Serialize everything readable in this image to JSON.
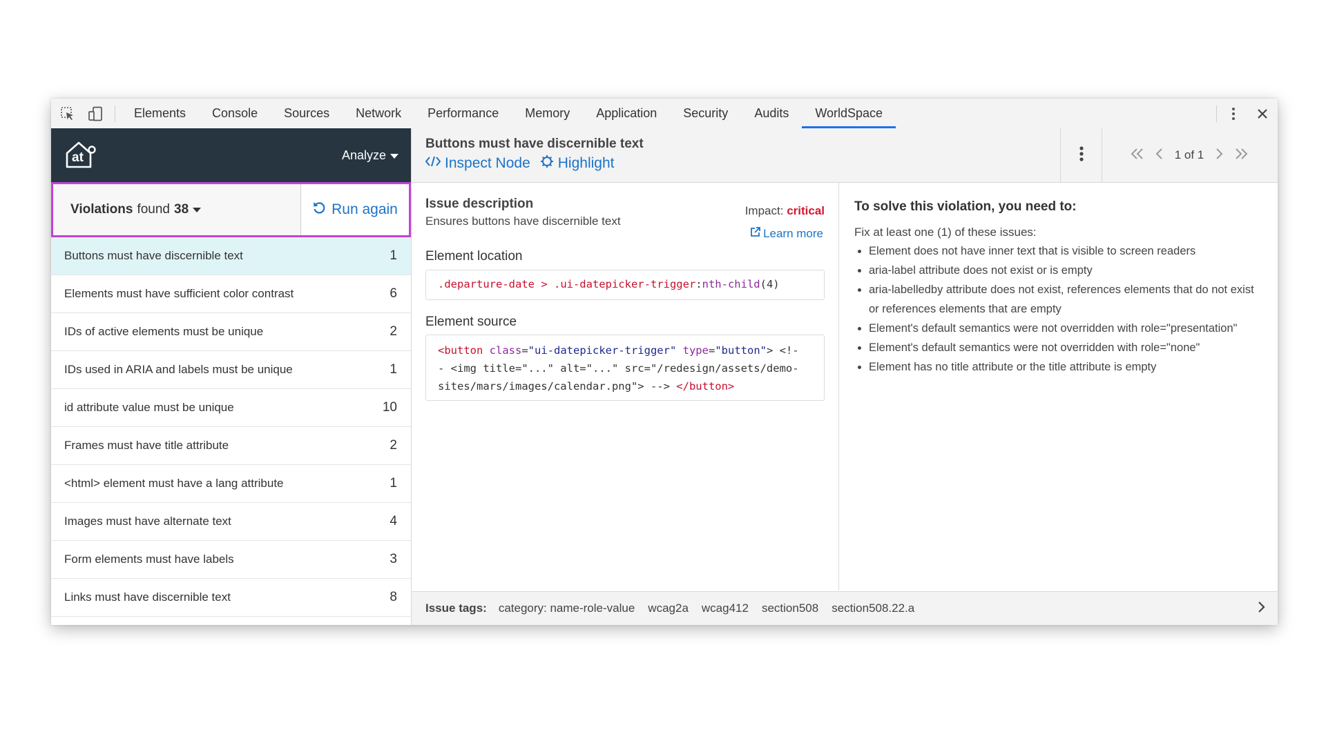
{
  "devtools": {
    "tabs": [
      {
        "label": "Elements"
      },
      {
        "label": "Console"
      },
      {
        "label": "Sources"
      },
      {
        "label": "Network"
      },
      {
        "label": "Performance"
      },
      {
        "label": "Memory"
      },
      {
        "label": "Application"
      },
      {
        "label": "Security"
      },
      {
        "label": "Audits"
      },
      {
        "label": "WorldSpace",
        "active": true
      }
    ]
  },
  "brand": {
    "logo_text": "at",
    "analyze_label": "Analyze"
  },
  "violations": {
    "label": "Violations",
    "found_label": "found",
    "count": "38",
    "run_again_label": "Run again",
    "items": [
      {
        "label": "Buttons must have discernible text",
        "count": "1",
        "selected": true
      },
      {
        "label": "Elements must have sufficient color contrast",
        "count": "6"
      },
      {
        "label": "IDs of active elements must be unique",
        "count": "2"
      },
      {
        "label": "IDs used in ARIA and labels must be unique",
        "count": "1"
      },
      {
        "label": "id attribute value must be unique",
        "count": "10"
      },
      {
        "label": "Frames must have title attribute",
        "count": "2"
      },
      {
        "label": "<html> element must have a lang attribute",
        "count": "1"
      },
      {
        "label": "Images must have alternate text",
        "count": "4"
      },
      {
        "label": "Form elements must have labels",
        "count": "3"
      },
      {
        "label": "Links must have discernible text",
        "count": "8"
      }
    ]
  },
  "detail": {
    "title": "Buttons must have discernible text",
    "inspect_label": "Inspect Node",
    "highlight_label": "Highlight",
    "pager": "1 of 1",
    "issue_description_title": "Issue description",
    "issue_description": "Ensures buttons have discernible text",
    "impact_label": "Impact:",
    "impact_value": "critical",
    "learn_more": "Learn more",
    "element_location_title": "Element location",
    "location": {
      "sel1": ".departure-date",
      "combinator": " > ",
      "sel2": ".ui-datepicker-trigger",
      "colon": ":",
      "pseudo": "nth-child",
      "arg": "(4)"
    },
    "element_source_title": "Element source",
    "source": {
      "l1_open": "<button",
      "l1_attr1": " class",
      "l1_eq1": "=",
      "l1_val1": "\"ui-datepicker-trigger\"",
      "l1_attr2": " type",
      "l1_eq2": "=",
      "l1_val2": "\"button\"",
      "l1_close": "> <!-",
      "l2": "- <img title=\"...\" alt=\"...\" src=\"/redesign/assets/demo-",
      "l3_text": "sites/mars/images/calendar.png\"> --> ",
      "l3_end": "</button>"
    }
  },
  "solve": {
    "title": "To solve this violation, you need to:",
    "fix_intro": "Fix at least one (1) of these issues:",
    "items": [
      "Element does not have inner text that is visible to screen readers",
      "aria-label attribute does not exist or is empty",
      "aria-labelledby attribute does not exist, references elements that do not exist or references elements that are empty",
      "Element's default semantics were not overridden with role=\"presentation\"",
      "Element's default semantics were not overridden with role=\"none\"",
      "Element has no title attribute or the title attribute is empty"
    ]
  },
  "tags": {
    "label": "Issue tags:",
    "items": [
      "category: name-role-value",
      "wcag2a",
      "wcag412",
      "section508",
      "section508.22.a"
    ]
  },
  "colors": {
    "brand_bar": "#263540",
    "link": "#1b73c9",
    "critical": "#d3182e",
    "selected_row": "#dff4f7",
    "highlight_border": "#c342d6",
    "active_tab_underline": "#1a73e8"
  },
  "icons": [
    "inspect-element-icon",
    "device-toolbar-icon",
    "more-vertical-icon",
    "close-icon",
    "home-logo-icon",
    "caret-down-icon",
    "refresh-icon",
    "code-icon",
    "highlight-icon",
    "first-page-icon",
    "prev-page-icon",
    "next-page-icon",
    "last-page-icon",
    "external-link-icon",
    "chevron-right-icon"
  ]
}
